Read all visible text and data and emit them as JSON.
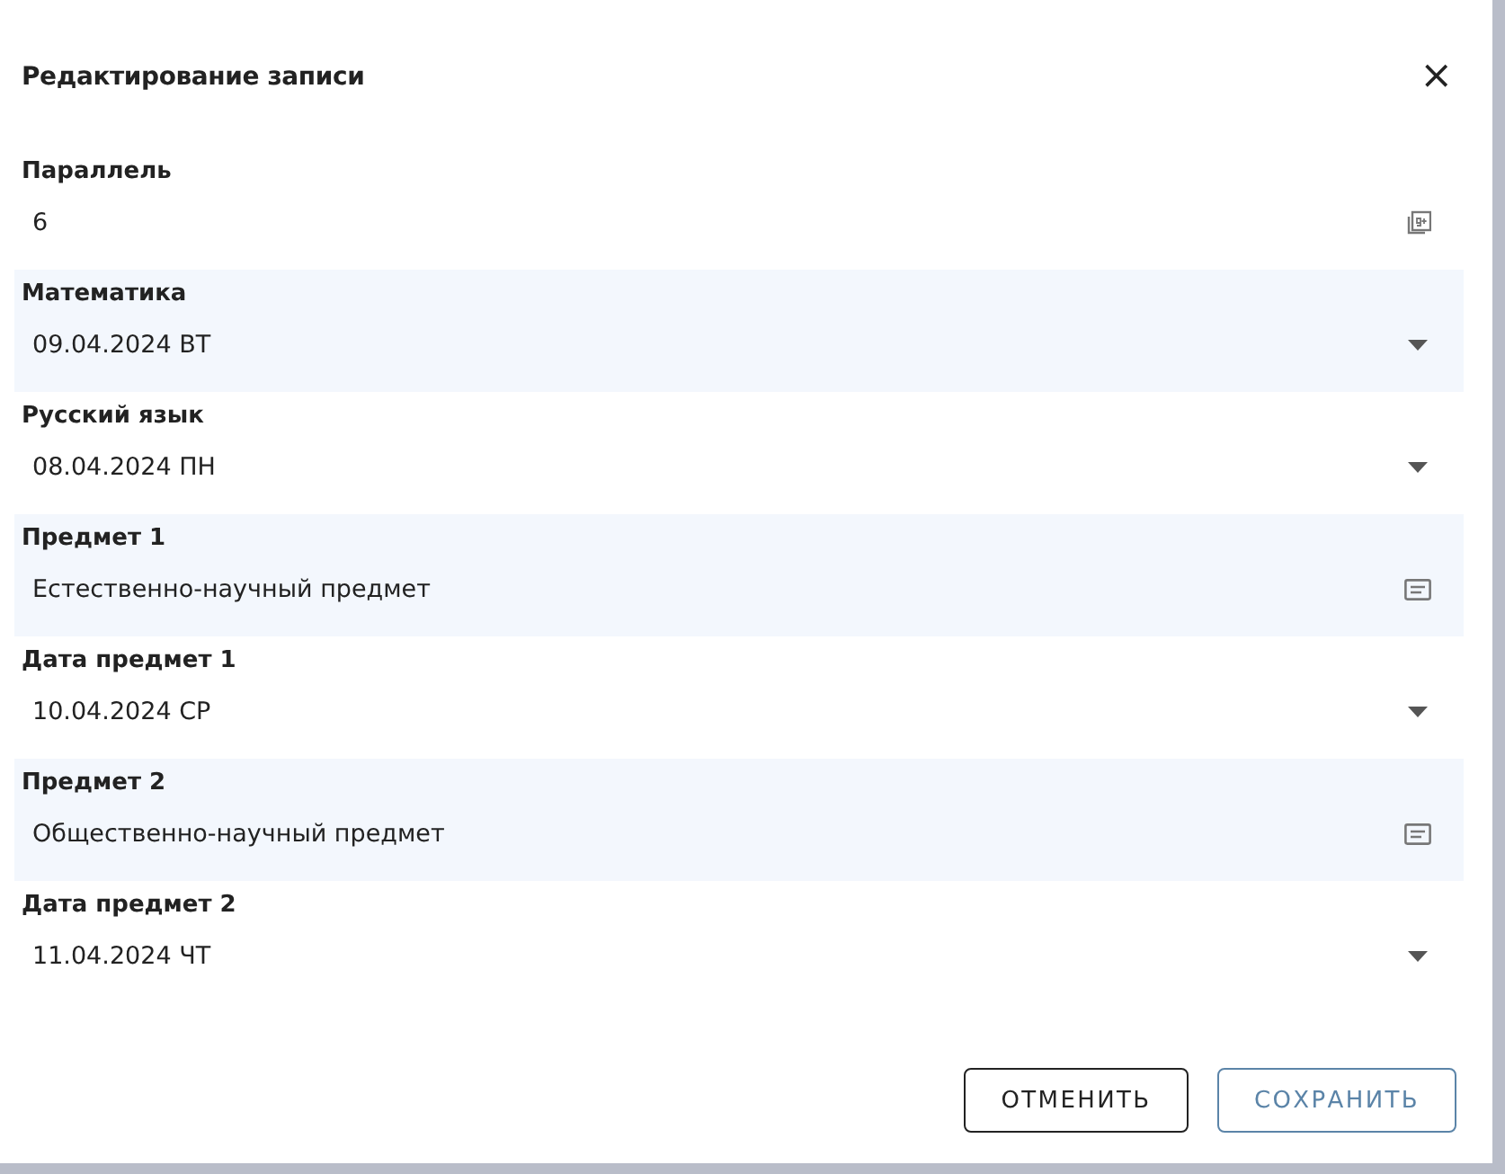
{
  "dialog": {
    "title": "Редактирование записи",
    "close": "×"
  },
  "fields": [
    {
      "label": "Параллель",
      "value": "6",
      "kind": "number"
    },
    {
      "label": "Математика",
      "value": "09.04.2024 ВТ",
      "kind": "select"
    },
    {
      "label": "Русский язык",
      "value": "08.04.2024 ПН",
      "kind": "select"
    },
    {
      "label": "Предмет 1",
      "value": "Естественно-научный предмет",
      "kind": "list"
    },
    {
      "label": "Дата предмет 1",
      "value": "10.04.2024 СР",
      "kind": "select"
    },
    {
      "label": "Предмет 2",
      "value": "Общественно-научный предмет",
      "kind": "list"
    },
    {
      "label": "Дата предмет 2",
      "value": "11.04.2024 ЧТ",
      "kind": "select"
    }
  ],
  "buttons": [
    {
      "label": "ОТМЕНИТЬ",
      "kind": "secondary"
    },
    {
      "label": "СОХРАНИТЬ",
      "kind": "primary"
    }
  ]
}
